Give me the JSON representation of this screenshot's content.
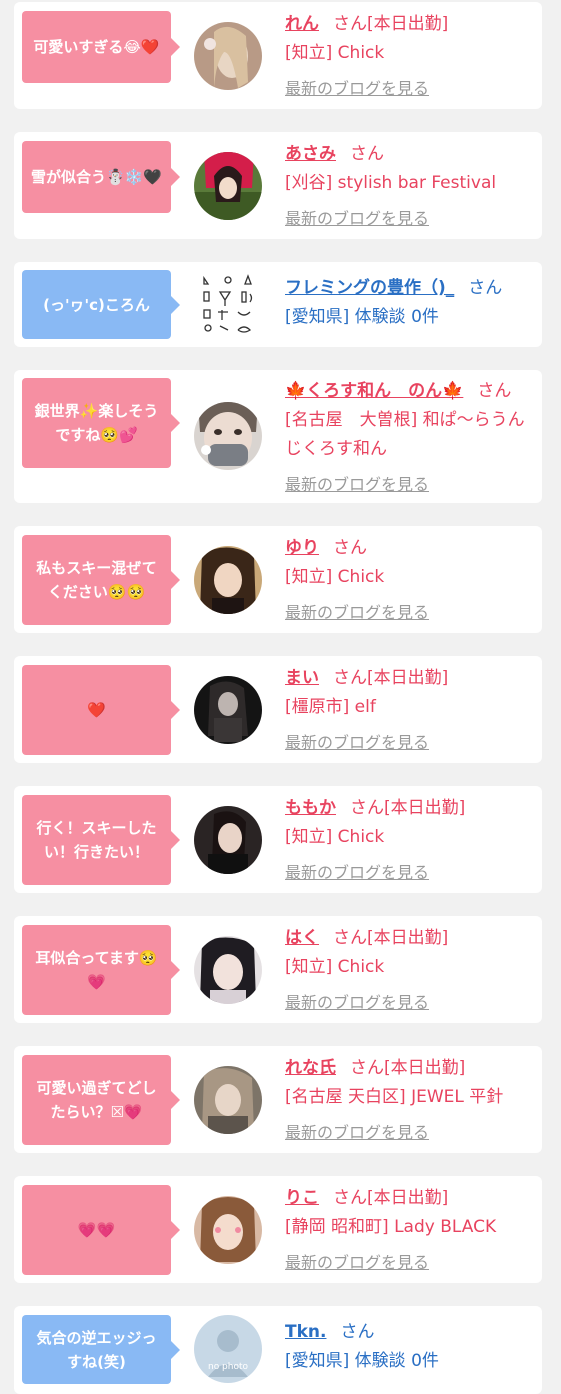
{
  "blog_link_label": "最新のブログを見る",
  "entries": [
    {
      "comment": "可愛いすぎる😂❤️",
      "name": "れん",
      "suffix": "さん[本日出勤]",
      "shop": "[知立] Chick",
      "blog": "最新のブログを見る",
      "type": "cast"
    },
    {
      "comment": "雪が似合う☃️❄️🖤",
      "name": "あさみ",
      "suffix": "さん",
      "shop": "[刈谷] stylish bar Festival",
      "blog": "最新のブログを見る",
      "type": "cast"
    },
    {
      "comment": "(っ'ヮ'c)ころん",
      "name": "フレミングの豊作（)_",
      "suffix": "さん",
      "shop": "[愛知県] 体験談 0件",
      "type": "user"
    },
    {
      "comment": "銀世界✨楽しそうですね🥺💕",
      "name": "🍁くろす和ん　のん🍁",
      "suffix": "さん",
      "shop": "[名古屋　大曽根] 和ぱ〜らうんじくろす和ん",
      "blog": "最新のブログを見る",
      "type": "cast"
    },
    {
      "comment": "私もスキー混ぜてください🥺🥺",
      "name": "ゆり",
      "suffix": "さん",
      "shop": "[知立] Chick",
      "blog": "最新のブログを見る",
      "type": "cast"
    },
    {
      "comment": "❤️",
      "name": "まい",
      "suffix": "さん[本日出勤]",
      "shop": "[橿原市] elf",
      "blog": "最新のブログを見る",
      "type": "cast"
    },
    {
      "comment": "行く！スキーしたい！行きたい！",
      "name": "ももか",
      "suffix": "さん[本日出勤]",
      "shop": "[知立] Chick",
      "blog": "最新のブログを見る",
      "type": "cast"
    },
    {
      "comment": "耳似合ってます🥺💗",
      "name": "はく",
      "suffix": "さん[本日出勤]",
      "shop": "[知立] Chick",
      "blog": "最新のブログを見る",
      "type": "cast"
    },
    {
      "comment": "可愛い過ぎてどしたらい？☒💗",
      "name": "れな氏",
      "suffix": "さん[本日出勤]",
      "shop": "[名古屋 天白区] JEWEL 平針",
      "blog": "最新のブログを見る",
      "type": "cast"
    },
    {
      "comment": "💗💗",
      "name": "りこ",
      "suffix": "さん[本日出勤]",
      "shop": "[静岡 昭和町] Lady BLACK",
      "blog": "最新のブログを見る",
      "type": "cast"
    },
    {
      "comment": "気合の逆エッジっすね(笑)",
      "name": "Tkn.",
      "suffix": "さん",
      "shop": "[愛知県] 体験談 0件",
      "type": "user",
      "avatar_label": "no photo"
    }
  ],
  "colors": {
    "pink_bubble": "#f68fa2",
    "blue_bubble": "#89b9f4",
    "cast_text": "#e8435f",
    "user_text": "#2a6fc4",
    "blog_link": "#9a9a9a",
    "background": "#f1f1f1"
  },
  "icons": [
    "profile-photo",
    "placeholder-avatar-icon"
  ]
}
